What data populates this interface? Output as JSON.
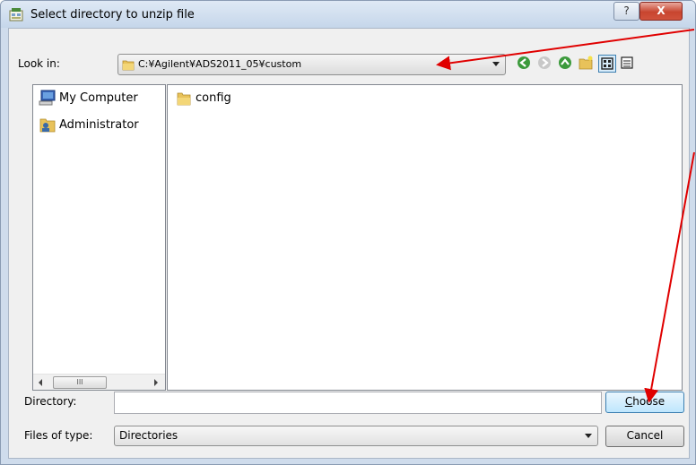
{
  "window": {
    "title": "Select directory to unzip file",
    "help_glyph": "?",
    "close_glyph": "X"
  },
  "lookin": {
    "label": "Look in:",
    "path": "C:¥Agilent¥ADS2011_05¥custom"
  },
  "toolbar": {
    "buttons": [
      "back-icon",
      "forward-icon",
      "up-folder-icon",
      "new-folder-icon",
      "list-view-icon",
      "details-view-icon"
    ]
  },
  "places": {
    "items": [
      {
        "label": "My Computer",
        "icon": "computer-icon"
      },
      {
        "label": "Administrator",
        "icon": "user-folder-icon"
      }
    ],
    "scroll_thumb_glyph": "III"
  },
  "files": {
    "items": [
      {
        "label": "config",
        "icon": "folder-icon"
      }
    ]
  },
  "directory": {
    "label": "Directory:",
    "value": "",
    "choose_mnemonic": "C",
    "choose_rest": "hoose"
  },
  "filetype": {
    "label": "Files of type:",
    "selected": "Directories",
    "cancel_label": "Cancel"
  },
  "colors": {
    "annotation_arrow": "#e00000",
    "titlebar": "#cfdcec",
    "close_button": "#c8452f"
  }
}
